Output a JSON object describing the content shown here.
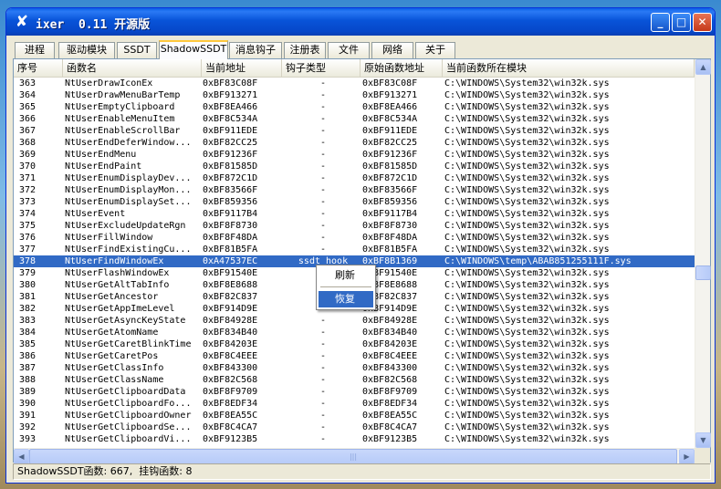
{
  "window": {
    "title": "ixer  0.11 开源版",
    "icon": "x-logo-icon",
    "controls": {
      "minimize": "_",
      "maximize": "□",
      "close": "✕"
    }
  },
  "tabs": [
    {
      "label": "进程"
    },
    {
      "label": "驱动模块"
    },
    {
      "label": "SSDT"
    },
    {
      "label": "ShadowSSDT",
      "active": true
    },
    {
      "label": "消息钩子"
    },
    {
      "label": "注册表"
    },
    {
      "label": "文件"
    },
    {
      "label": "网络"
    },
    {
      "label": "关于"
    }
  ],
  "table": {
    "headers": {
      "no": "序号",
      "name": "函数名",
      "current_addr": "当前地址",
      "hook_type": "钩子类型",
      "orig_addr": "原始函数地址",
      "module": "当前函数所在模块"
    },
    "rows": [
      {
        "no": "363",
        "name": "NtUserDrawIconEx",
        "current_addr": "0xBF83C08F",
        "hook_type": "-",
        "orig_addr": "0xBF83C08F",
        "module": "C:\\WINDOWS\\System32\\win32k.sys"
      },
      {
        "no": "364",
        "name": "NtUserDrawMenuBarTemp",
        "current_addr": "0xBF913271",
        "hook_type": "-",
        "orig_addr": "0xBF913271",
        "module": "C:\\WINDOWS\\System32\\win32k.sys"
      },
      {
        "no": "365",
        "name": "NtUserEmptyClipboard",
        "current_addr": "0xBF8EA466",
        "hook_type": "-",
        "orig_addr": "0xBF8EA466",
        "module": "C:\\WINDOWS\\System32\\win32k.sys"
      },
      {
        "no": "366",
        "name": "NtUserEnableMenuItem",
        "current_addr": "0xBF8C534A",
        "hook_type": "-",
        "orig_addr": "0xBF8C534A",
        "module": "C:\\WINDOWS\\System32\\win32k.sys"
      },
      {
        "no": "367",
        "name": "NtUserEnableScrollBar",
        "current_addr": "0xBF911EDE",
        "hook_type": "-",
        "orig_addr": "0xBF911EDE",
        "module": "C:\\WINDOWS\\System32\\win32k.sys"
      },
      {
        "no": "368",
        "name": "NtUserEndDeferWindow...",
        "current_addr": "0xBF82CC25",
        "hook_type": "-",
        "orig_addr": "0xBF82CC25",
        "module": "C:\\WINDOWS\\System32\\win32k.sys"
      },
      {
        "no": "369",
        "name": "NtUserEndMenu",
        "current_addr": "0xBF91236F",
        "hook_type": "-",
        "orig_addr": "0xBF91236F",
        "module": "C:\\WINDOWS\\System32\\win32k.sys"
      },
      {
        "no": "370",
        "name": "NtUserEndPaint",
        "current_addr": "0xBF81585D",
        "hook_type": "-",
        "orig_addr": "0xBF81585D",
        "module": "C:\\WINDOWS\\System32\\win32k.sys"
      },
      {
        "no": "371",
        "name": "NtUserEnumDisplayDev...",
        "current_addr": "0xBF872C1D",
        "hook_type": "-",
        "orig_addr": "0xBF872C1D",
        "module": "C:\\WINDOWS\\System32\\win32k.sys"
      },
      {
        "no": "372",
        "name": "NtUserEnumDisplayMon...",
        "current_addr": "0xBF83566F",
        "hook_type": "-",
        "orig_addr": "0xBF83566F",
        "module": "C:\\WINDOWS\\System32\\win32k.sys"
      },
      {
        "no": "373",
        "name": "NtUserEnumDisplaySet...",
        "current_addr": "0xBF859356",
        "hook_type": "-",
        "orig_addr": "0xBF859356",
        "module": "C:\\WINDOWS\\System32\\win32k.sys"
      },
      {
        "no": "374",
        "name": "NtUserEvent",
        "current_addr": "0xBF9117B4",
        "hook_type": "-",
        "orig_addr": "0xBF9117B4",
        "module": "C:\\WINDOWS\\System32\\win32k.sys"
      },
      {
        "no": "375",
        "name": "NtUserExcludeUpdateRgn",
        "current_addr": "0xBF8F8730",
        "hook_type": "-",
        "orig_addr": "0xBF8F8730",
        "module": "C:\\WINDOWS\\System32\\win32k.sys"
      },
      {
        "no": "376",
        "name": "NtUserFillWindow",
        "current_addr": "0xBF8F48DA",
        "hook_type": "-",
        "orig_addr": "0xBF8F48DA",
        "module": "C:\\WINDOWS\\System32\\win32k.sys"
      },
      {
        "no": "377",
        "name": "NtUserFindExistingCu...",
        "current_addr": "0xBF81B5FA",
        "hook_type": "-",
        "orig_addr": "0xBF81B5FA",
        "module": "C:\\WINDOWS\\System32\\win32k.sys"
      },
      {
        "no": "378",
        "name": "NtUserFindWindowEx",
        "current_addr": "0xA47537EC",
        "hook_type": "ssdt hook",
        "orig_addr": "0xBF8B1369",
        "module": "C:\\WINDOWS\\temp\\ABAB851255111F.sys",
        "selected": true
      },
      {
        "no": "379",
        "name": "NtUserFlashWindowEx",
        "current_addr": "0xBF91540E",
        "hook_type": "-",
        "orig_addr": "0xBF91540E",
        "module": "C:\\WINDOWS\\System32\\win32k.sys"
      },
      {
        "no": "380",
        "name": "NtUserGetAltTabInfo",
        "current_addr": "0xBF8E8688",
        "hook_type": "-",
        "orig_addr": "0xBF8E8688",
        "module": "C:\\WINDOWS\\System32\\win32k.sys"
      },
      {
        "no": "381",
        "name": "NtUserGetAncestor",
        "current_addr": "0xBF82C837",
        "hook_type": "-",
        "orig_addr": "0xBF82C837",
        "module": "C:\\WINDOWS\\System32\\win32k.sys"
      },
      {
        "no": "382",
        "name": "NtUserGetAppImeLevel",
        "current_addr": "0xBF914D9E",
        "hook_type": "-",
        "orig_addr": "0xBF914D9E",
        "module": "C:\\WINDOWS\\System32\\win32k.sys"
      },
      {
        "no": "383",
        "name": "NtUserGetAsyncKeyState",
        "current_addr": "0xBF84928E",
        "hook_type": "-",
        "orig_addr": "0xBF84928E",
        "module": "C:\\WINDOWS\\System32\\win32k.sys"
      },
      {
        "no": "384",
        "name": "NtUserGetAtomName",
        "current_addr": "0xBF834B40",
        "hook_type": "-",
        "orig_addr": "0xBF834B40",
        "module": "C:\\WINDOWS\\System32\\win32k.sys"
      },
      {
        "no": "385",
        "name": "NtUserGetCaretBlinkTime",
        "current_addr": "0xBF84203E",
        "hook_type": "-",
        "orig_addr": "0xBF84203E",
        "module": "C:\\WINDOWS\\System32\\win32k.sys"
      },
      {
        "no": "386",
        "name": "NtUserGetCaretPos",
        "current_addr": "0xBF8C4EEE",
        "hook_type": "-",
        "orig_addr": "0xBF8C4EEE",
        "module": "C:\\WINDOWS\\System32\\win32k.sys"
      },
      {
        "no": "387",
        "name": "NtUserGetClassInfo",
        "current_addr": "0xBF843300",
        "hook_type": "-",
        "orig_addr": "0xBF843300",
        "module": "C:\\WINDOWS\\System32\\win32k.sys"
      },
      {
        "no": "388",
        "name": "NtUserGetClassName",
        "current_addr": "0xBF82C568",
        "hook_type": "-",
        "orig_addr": "0xBF82C568",
        "module": "C:\\WINDOWS\\System32\\win32k.sys"
      },
      {
        "no": "389",
        "name": "NtUserGetClipboardData",
        "current_addr": "0xBF8F9709",
        "hook_type": "-",
        "orig_addr": "0xBF8F9709",
        "module": "C:\\WINDOWS\\System32\\win32k.sys"
      },
      {
        "no": "390",
        "name": "NtUserGetClipboardFo...",
        "current_addr": "0xBF8EDF34",
        "hook_type": "-",
        "orig_addr": "0xBF8EDF34",
        "module": "C:\\WINDOWS\\System32\\win32k.sys"
      },
      {
        "no": "391",
        "name": "NtUserGetClipboardOwner",
        "current_addr": "0xBF8EA55C",
        "hook_type": "-",
        "orig_addr": "0xBF8EA55C",
        "module": "C:\\WINDOWS\\System32\\win32k.sys"
      },
      {
        "no": "392",
        "name": "NtUserGetClipboardSe...",
        "current_addr": "0xBF8C4CA7",
        "hook_type": "-",
        "orig_addr": "0xBF8C4CA7",
        "module": "C:\\WINDOWS\\System32\\win32k.sys"
      },
      {
        "no": "393",
        "name": "NtUserGetClipboardVi...",
        "current_addr": "0xBF9123B5",
        "hook_type": "-",
        "orig_addr": "0xBF9123B5",
        "module": "C:\\WINDOWS\\System32\\win32k.sys"
      }
    ]
  },
  "context_menu": {
    "refresh": "刷新",
    "restore": "恢复"
  },
  "status": {
    "text": "ShadowSSDT函数: 667,  挂钩函数: 8"
  },
  "colors": {
    "selection": "#316ac5",
    "titlebar": "#0853d8",
    "active_tab_accent": "#ffc83c"
  }
}
